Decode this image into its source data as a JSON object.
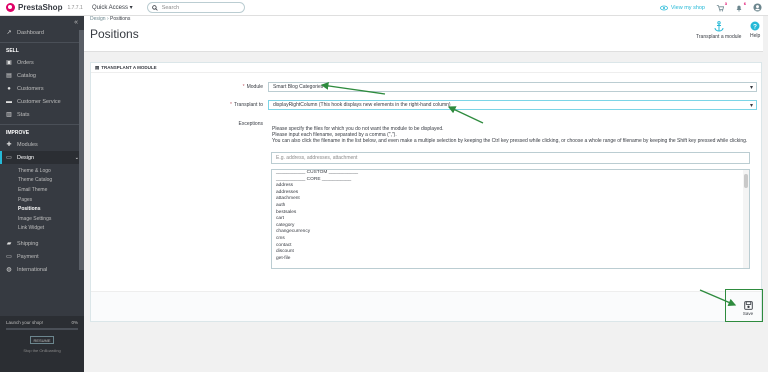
{
  "topbar": {
    "logo": "PrestaShop",
    "version": "1.7.7.1",
    "quick_access": "Quick Access ▾",
    "search_placeholder": "Search",
    "view_shop": "View my shop",
    "orders_badge": "3",
    "customers_badge": "6"
  },
  "sidebar": {
    "collapse": "«",
    "dashboard": "Dashboard",
    "sell_head": "SELL",
    "sell": [
      "Orders",
      "Catalog",
      "Customers",
      "Customer Service",
      "Stats"
    ],
    "improve_head": "IMPROVE",
    "modules": "Modules",
    "design": "Design",
    "design_sub": [
      "Theme & Logo",
      "Theme Catalog",
      "Email Theme",
      "Pages",
      "Positions",
      "Image Settings",
      "Link Widget"
    ],
    "configure": [
      "Shipping",
      "Payment",
      "International"
    ],
    "onboarding": {
      "label": "Launch your shop!",
      "percent": "0%",
      "resume": "RESUME",
      "stop": "Stop the OnBoarding"
    }
  },
  "header": {
    "breadcrumb_parent": "Design",
    "breadcrumb_current": "Positions",
    "title": "Positions",
    "transplant_action": "Transplant a module",
    "help_action": "Help"
  },
  "form": {
    "panel_title": "TRANSPLANT A MODULE",
    "module_label": "Module",
    "module_value": "Smart Blog Categories",
    "transplant_label": "Transplant to",
    "transplant_value": "displayRightColumn (This hook displays new elements in the right-hand column)",
    "exceptions_label": "Exceptions",
    "exceptions_help": [
      "Please specify the files for which you do not want the module to be displayed.",
      "Please input each filename, separated by a comma (\",\").",
      "You can also click the filename in the list below, and even make a multiple selection by keeping the Ctrl key pressed while clicking, or choose a whole range of filename by keeping the Shift key pressed while clicking."
    ],
    "exceptions_placeholder": "E.g. address, addresses, attachment",
    "exceptions_list": [
      "___________ CUSTOM ___________",
      "___________ CORE ___________",
      "address",
      "addresses",
      "attachment",
      "auth",
      "bestsales",
      "cart",
      "category",
      "changecurrency",
      "cms",
      "contact",
      "discount",
      "get-file"
    ],
    "save": "Save"
  },
  "colors": {
    "accent": "#25b9d7",
    "annotation": "#2e8b3e",
    "sidebar": "#363a41"
  },
  "icons": [
    "search-icon",
    "eye-icon",
    "cart-icon",
    "bell-icon",
    "user-icon",
    "anchor-icon",
    "help-icon",
    "save-icon"
  ]
}
